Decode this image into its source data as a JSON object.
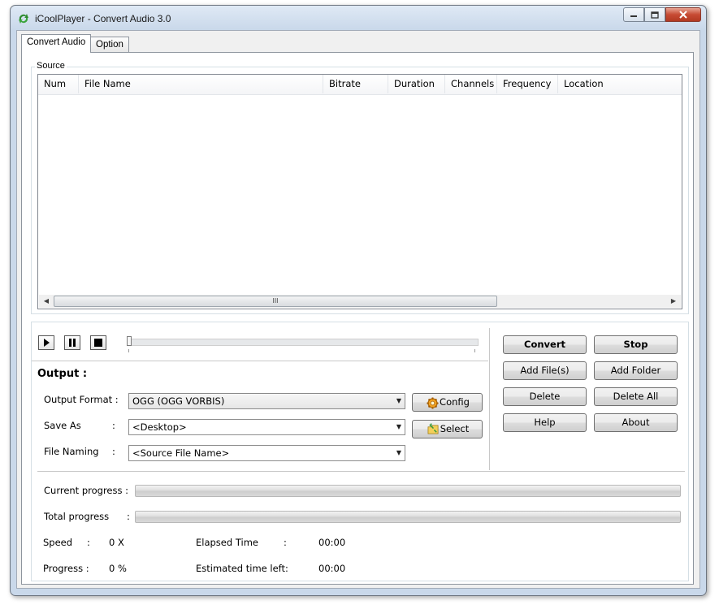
{
  "window": {
    "title": "iCoolPlayer - Convert Audio 3.0",
    "icon": "recycle-arrows-icon",
    "controls": {
      "minimize": "minimize-icon",
      "maximize": "maximize-icon",
      "close": "close-icon"
    }
  },
  "tabs": [
    {
      "label": "Convert Audio",
      "active": true
    },
    {
      "label": "Option",
      "active": false
    }
  ],
  "source": {
    "label": "Source",
    "columns": [
      "Num",
      "File Name",
      "Bitrate",
      "Duration",
      "Channels",
      "Frequency",
      "Location"
    ],
    "rows": [],
    "scroll_grip": "III"
  },
  "transport": {
    "play": "play-icon",
    "pause": "pause-icon",
    "stop": "stop-icon"
  },
  "output": {
    "heading": "Output :",
    "format_label": "Output Format :",
    "format_value": "OGG (OGG VORBIS)",
    "save_as_label": "Save As",
    "save_as_colon": ":",
    "save_as_value": "<Desktop>",
    "naming_label": "File Naming",
    "naming_colon": ":",
    "naming_value": "<Source File Name>",
    "config_label": "Config",
    "select_label": "Select"
  },
  "actions": {
    "convert": "Convert",
    "stop": "Stop",
    "add_files": "Add File(s)",
    "add_folder": "Add Folder",
    "delete": "Delete",
    "delete_all": "Delete All",
    "help": "Help",
    "about": "About"
  },
  "progress": {
    "current_label": "Current progress :",
    "current_value": 0,
    "total_label": "Total progress",
    "total_colon": ":",
    "total_value": 0
  },
  "stats": {
    "speed_label": "Speed",
    "speed_colon": ":",
    "speed_value": "0 X",
    "progress_label": "Progress :",
    "progress_value": "0 %",
    "elapsed_label": "Elapsed Time",
    "elapsed_colon": ":",
    "elapsed_value": "00:00",
    "estimated_label": "Estimated time left:",
    "estimated_value": "00:00"
  }
}
